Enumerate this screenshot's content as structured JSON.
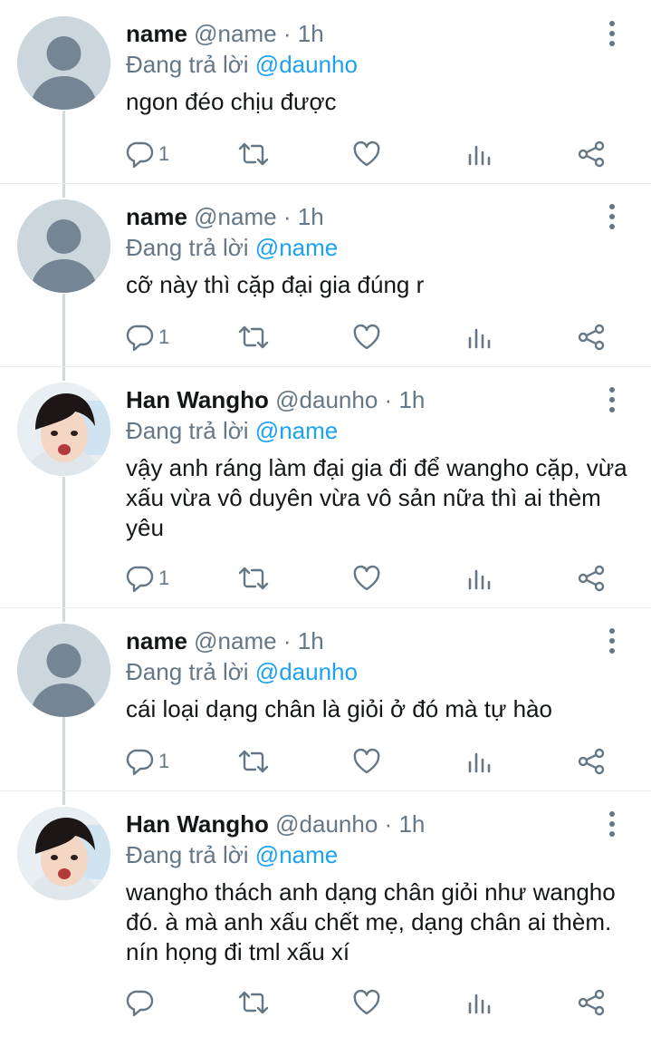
{
  "ui": {
    "replying_prefix": "Đang trả lời",
    "colors": {
      "text": "#14171a",
      "secondary": "#657786",
      "accent": "#1da1f2",
      "thread_line": "#cfd9de"
    },
    "icons": [
      "comment-icon",
      "retweet-icon",
      "like-icon",
      "analytics-icon",
      "share-icon",
      "more-options-icon"
    ]
  },
  "tweets": [
    {
      "display_name": "name",
      "handle": "@name",
      "dot": "·",
      "time": "1h",
      "replying_to": "@daunho",
      "text": "ngon đéo chịu được",
      "reply_count": "1",
      "avatar": "default"
    },
    {
      "display_name": "name",
      "handle": "@name",
      "dot": "·",
      "time": "1h",
      "replying_to": "@name",
      "text": "cỡ này thì cặp đại gia đúng r",
      "reply_count": "1",
      "avatar": "default"
    },
    {
      "display_name": "Han Wangho",
      "handle": "@daunho",
      "dot": "·",
      "time": "1h",
      "replying_to": "@name",
      "text": "vậy anh ráng làm đại gia đi để wangho cặp, vừa xấu vừa vô duyên vừa vô sản nữa thì ai thèm yêu",
      "reply_count": "1",
      "avatar": "photo"
    },
    {
      "display_name": "name",
      "handle": "@name",
      "dot": "·",
      "time": "1h",
      "replying_to": "@daunho",
      "text": "cái loại dạng chân là giỏi ở đó mà tự hào",
      "reply_count": "1",
      "avatar": "default"
    },
    {
      "display_name": "Han Wangho",
      "handle": "@daunho",
      "dot": "·",
      "time": "1h",
      "replying_to": "@name",
      "text": "wangho thách anh dạng chân giỏi như wangho đó. à mà anh xấu chết mẹ, dạng chân ai thèm. nín họng đi tml xấu xí",
      "reply_count": "",
      "avatar": "photo"
    }
  ]
}
